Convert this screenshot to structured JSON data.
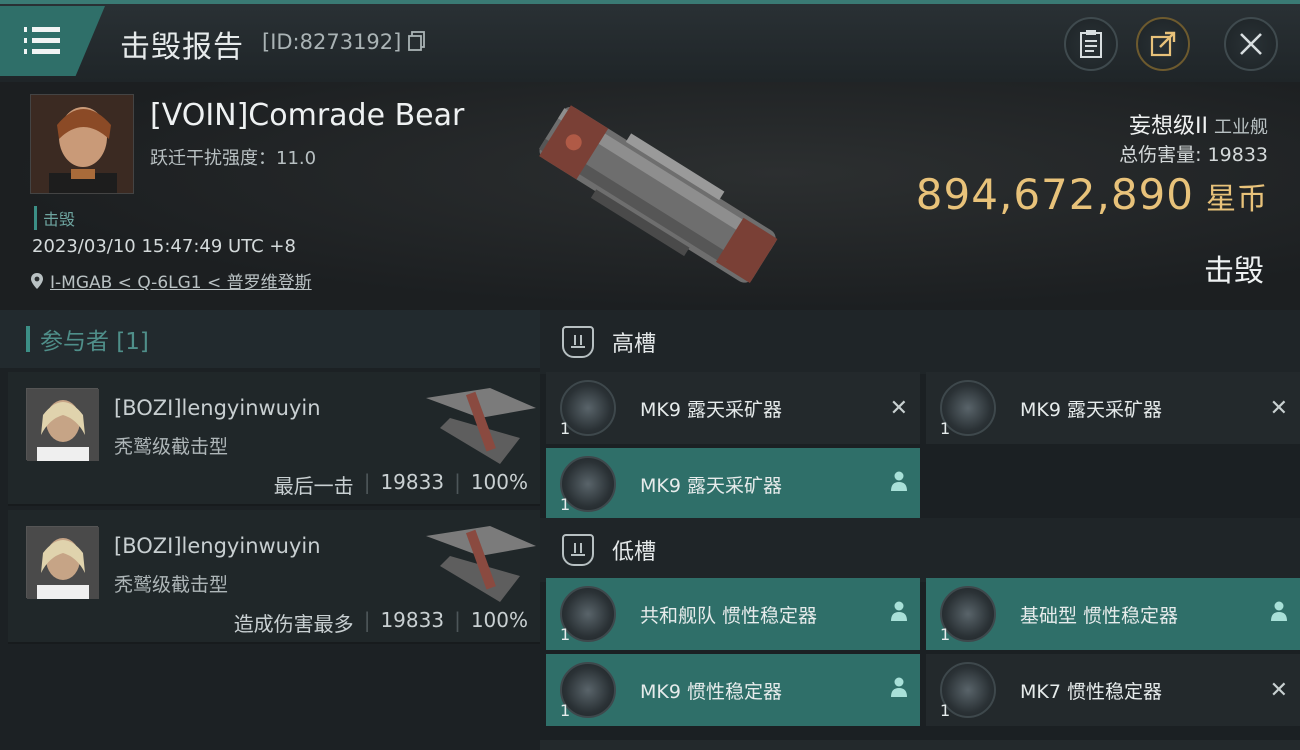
{
  "header": {
    "title": "击毁报告",
    "id_text": "[ID:8273192]"
  },
  "victim": {
    "name": "[VOIN]Comrade Bear",
    "warp_label": "跃迁干扰强度：11.0",
    "status_tag": "击毁",
    "timestamp": "2023/03/10 15:47:49 UTC +8",
    "location": "I-MGAB < Q-6LG1 < 普罗维登斯",
    "ship_name": "妄想级II",
    "ship_class": "工业舰",
    "total_damage": "总伤害量: 19833",
    "isk_value": "894,672,890",
    "isk_unit": "星币",
    "result": "击毁"
  },
  "participants": {
    "header": "参与者 [1]",
    "items": [
      {
        "name": "[BOZI]lengyinwuyin",
        "ship": "秃鹫级截击型",
        "role": "最后一击",
        "damage": "19833",
        "percent": "100%"
      },
      {
        "name": "[BOZI]lengyinwuyin",
        "ship": "秃鹫级截击型",
        "role": "造成伤害最多",
        "damage": "19833",
        "percent": "100%"
      }
    ]
  },
  "slots": {
    "high": {
      "label": "高槽",
      "modules": [
        {
          "name": "MK9 露天采矿器",
          "qty": "1",
          "status": "destroyed-x-icon"
        },
        {
          "name": "MK9 露天采矿器",
          "qty": "1",
          "status": "destroyed-x-icon"
        },
        {
          "name": "MK9 露天采矿器",
          "qty": "1",
          "status": "dropped-person-icon"
        }
      ]
    },
    "low": {
      "label": "低槽",
      "modules": [
        {
          "name": "共和舰队 惯性稳定器",
          "qty": "1",
          "status": "dropped-person-icon"
        },
        {
          "name": "基础型 惯性稳定器",
          "qty": "1",
          "status": "dropped-person-icon"
        },
        {
          "name": "MK9 惯性稳定器",
          "qty": "1",
          "status": "dropped-person-icon"
        },
        {
          "name": "MK7 惯性稳定器",
          "qty": "1",
          "status": "destroyed-x-icon"
        }
      ]
    }
  },
  "colors": {
    "accent": "#2f6f69",
    "isk": "#e8c27a",
    "background": "#1a1e21"
  }
}
